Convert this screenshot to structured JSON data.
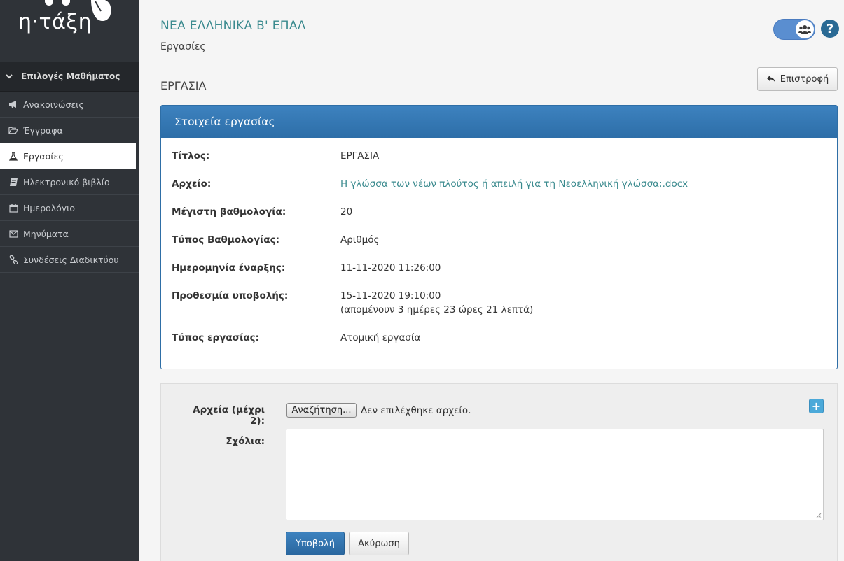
{
  "logo": {
    "text": "η·τάξη"
  },
  "sidebar": {
    "section_label": "Επιλογές Μαθήματος",
    "items": [
      {
        "label": "Ανακοινώσεις",
        "icon": "megaphone-icon",
        "active": false
      },
      {
        "label": "Έγγραφα",
        "icon": "folder-open-icon",
        "active": false
      },
      {
        "label": "Εργασίες",
        "icon": "flask-icon",
        "active": true
      },
      {
        "label": "Ηλεκτρονικό βιβλίο",
        "icon": "book-icon",
        "active": false
      },
      {
        "label": "Ημερολόγιο",
        "icon": "calendar-icon",
        "active": false
      },
      {
        "label": "Μηνύματα",
        "icon": "envelope-icon",
        "active": false
      },
      {
        "label": "Συνδέσεις Διαδικτύου",
        "icon": "link-icon",
        "active": false
      }
    ]
  },
  "header": {
    "course_title": "ΝΕΑ ΕΛΛΗΝΙΚΑ Β' ΕΠΑΛ",
    "subtitle": "Εργασίες",
    "help_symbol": "?",
    "toggle_icon": "users-icon"
  },
  "page": {
    "heading": "ΕΡΓΑΣΙΑ",
    "back_label": "Επιστροφή"
  },
  "details": {
    "panel_title": "Στοιχεία εργασίας",
    "title_label": "Τίτλος:",
    "title_value": "ΕΡΓΑΣΙΑ",
    "file_label": "Αρχείο:",
    "file_value": "Η γλώσσα των νέων πλούτος ή απειλή για τη Νεοελληνική γλώσσα;.docx",
    "max_grade_label": "Μέγιστη βαθμολογία:",
    "max_grade_value": "20",
    "grade_type_label": "Τύπος Βαθμολογίας:",
    "grade_type_value": "Αριθμός",
    "start_label": "Ημερομηνία έναρξης:",
    "start_value": "11-11-2020 11:26:00",
    "deadline_label": "Προθεσμία υποβολής:",
    "deadline_value": "15-11-2020 19:10:00",
    "remaining_value": "(απομένουν 3 ημέρες 23 ώρες 21 λεπτά)",
    "type_label": "Τύπος εργασίας:",
    "type_value": "Ατομική εργασία"
  },
  "form": {
    "files_label": "Αρχεία (μέχρι 2):",
    "browse_label": "Αναζήτηση...",
    "no_file_text": "Δεν επιλέχθηκε αρχείο.",
    "add_symbol": "+",
    "comments_label": "Σχόλια:",
    "comments_value": "",
    "submit_label": "Υποβολή",
    "cancel_label": "Ακύρωση"
  },
  "colors": {
    "accent": "#3a8a8e",
    "primary": "#3278b5",
    "sidebar_bg": "#2f3338"
  }
}
